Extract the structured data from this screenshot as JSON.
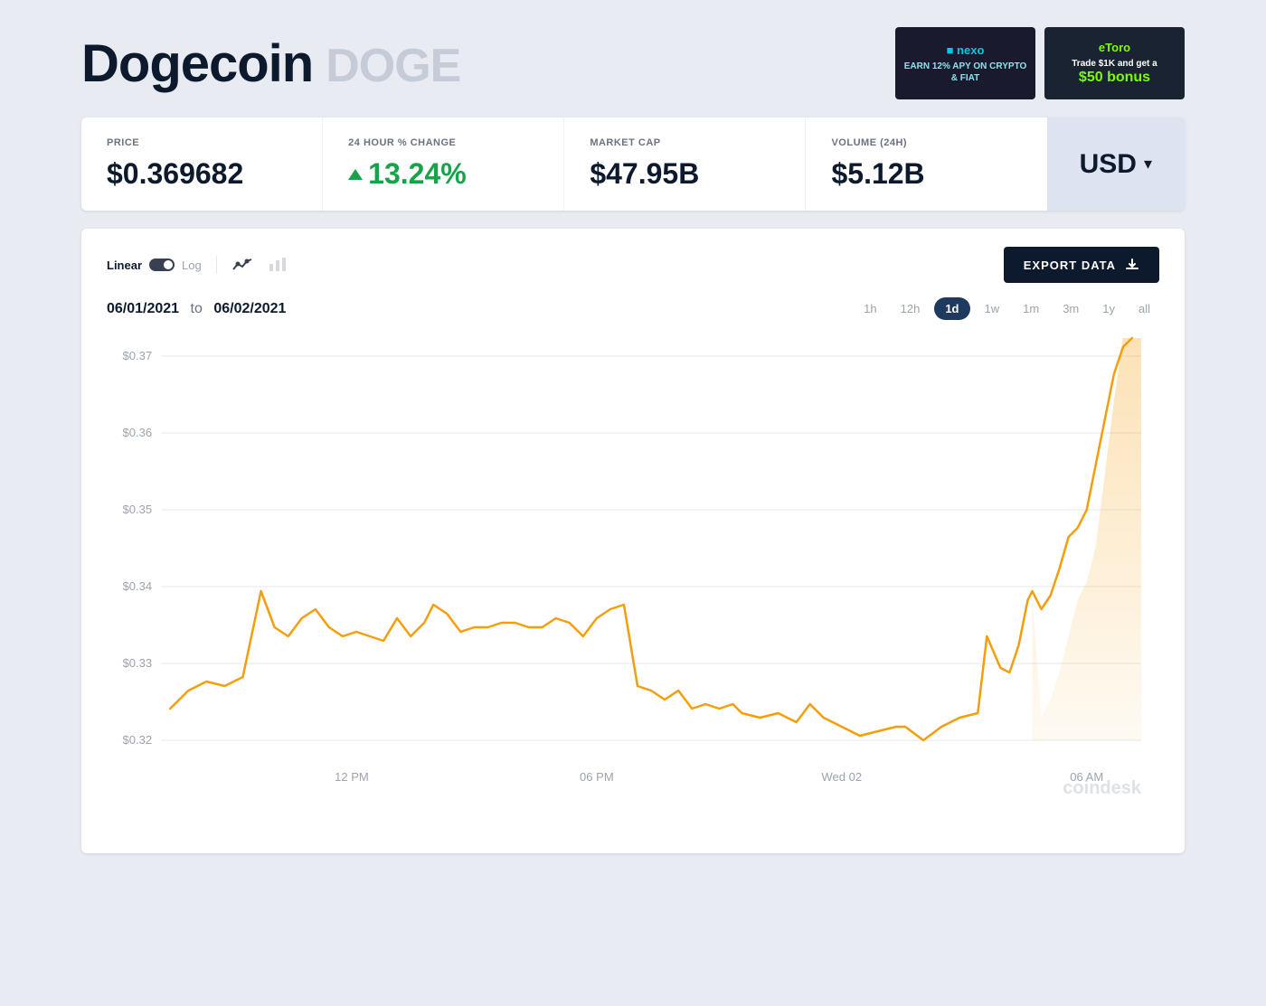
{
  "header": {
    "coin_name": "Dogecoin",
    "coin_symbol": "DOGE"
  },
  "ads": {
    "nexo": {
      "logo": "nexo",
      "text": "EARN 12% APY ON CRYPTO & FIAT"
    },
    "etoro": {
      "logo": "eToro",
      "text": "Trade $1K and get a",
      "bonus": "$50 bonus"
    }
  },
  "stats": {
    "price_label": "PRICE",
    "price_value": "$0.369682",
    "change_label": "24 HOUR % CHANGE",
    "change_value": "13.24%",
    "marketcap_label": "MARKET CAP",
    "marketcap_value": "$47.95B",
    "volume_label": "VOLUME (24H)",
    "volume_value": "$5.12B",
    "currency": "USD"
  },
  "chart": {
    "export_label": "EXPORT DATA",
    "linear_label": "Linear",
    "log_label": "Log",
    "date_from": "06/01/2021",
    "date_separator": "to",
    "date_to": "06/02/2021",
    "time_filters": [
      "1h",
      "12h",
      "1d",
      "1w",
      "1m",
      "3m",
      "1y",
      "all"
    ],
    "active_filter": "1d",
    "y_axis_labels": [
      "$0.37",
      "$0.36",
      "$0.35",
      "$0.34",
      "$0.33",
      "$0.32"
    ],
    "x_axis_labels": [
      "12 PM",
      "06 PM",
      "Wed 02",
      "06 AM"
    ],
    "watermark": "coindesk"
  }
}
